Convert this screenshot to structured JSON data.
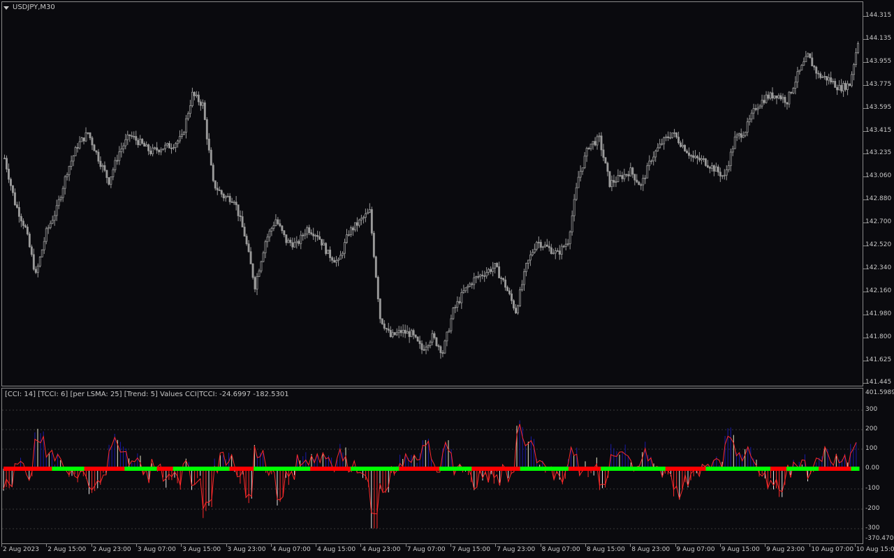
{
  "chart": {
    "symbol_title": "USDJPY,M30",
    "indicator_title": "[CCI: 14] [TCCI: 6] [per LSMA: 25] [Trend: 5] Values CCI|TCCI: -24.6997 -182.5301"
  },
  "price_axis": [
    "144.315",
    "144.135",
    "143.955",
    "143.775",
    "143.595",
    "143.415",
    "143.235",
    "143.060",
    "142.880",
    "142.700",
    "142.520",
    "142.340",
    "142.160",
    "141.980",
    "141.800",
    "141.625",
    "141.445"
  ],
  "indicator_axis": {
    "max_label": "401.5989",
    "min_label": "-370.4702",
    "levels": [
      "300",
      "200",
      "100",
      "0.00",
      "-100",
      "-200",
      "-300"
    ]
  },
  "time_axis": [
    "2 Aug 2023",
    "2 Aug 15:00",
    "2 Aug 23:00",
    "3 Aug 07:00",
    "3 Aug 15:00",
    "3 Aug 23:00",
    "4 Aug 07:00",
    "4 Aug 15:00",
    "4 Aug 23:00",
    "7 Aug 07:00",
    "7 Aug 15:00",
    "7 Aug 23:00",
    "8 Aug 07:00",
    "8 Aug 15:00",
    "8 Aug 23:00",
    "9 Aug 07:00",
    "9 Aug 15:00",
    "9 Aug 23:00",
    "10 Aug 07:00",
    "10 Aug 15:00"
  ],
  "colors": {
    "background": "#0a0a0e",
    "candle": "#9a9a9a",
    "cci_line": "#ff2a2a",
    "tcci_hist_up": "#1a1aa8",
    "trend_up": "#00ff00",
    "trend_down": "#ff0000",
    "grid": "#3a3a3a",
    "text": "#c8c8c8"
  },
  "chart_data": {
    "type": "candlestick_with_indicator",
    "price_close_path": [
      143.2,
      142.85,
      142.65,
      142.28,
      142.62,
      142.8,
      143.1,
      143.3,
      143.4,
      143.2,
      143.02,
      143.25,
      143.38,
      143.32,
      143.25,
      143.28,
      143.3,
      143.36,
      143.7,
      143.62,
      143.0,
      142.9,
      142.88,
      142.6,
      142.2,
      142.55,
      142.72,
      142.55,
      142.52,
      142.65,
      142.6,
      142.45,
      142.38,
      142.62,
      142.7,
      142.78,
      141.95,
      141.8,
      141.84,
      141.82,
      141.7,
      141.8,
      141.68,
      142.0,
      142.15,
      142.25,
      142.3,
      142.35,
      142.2,
      142.0,
      142.35,
      142.55,
      142.5,
      142.45,
      142.55,
      143.05,
      143.3,
      143.35,
      143.0,
      143.05,
      143.1,
      142.98,
      143.2,
      143.32,
      143.4,
      143.3,
      143.2,
      143.18,
      143.12,
      143.05,
      143.35,
      143.42,
      143.6,
      143.68,
      143.7,
      143.65,
      143.85,
      144.0,
      143.85,
      143.82,
      143.75,
      143.78,
      144.2
    ],
    "trend_segments": [
      {
        "from": "2 Aug 2023",
        "to": "2 Aug 15:00",
        "state": "down"
      },
      {
        "from": "2 Aug 15:00",
        "to": "2 Aug 23:00",
        "state": "down"
      },
      {
        "from": "3 Aug 07:00",
        "to": "3 Aug 15:00",
        "state": "up"
      },
      {
        "from": "3 Aug 23:00",
        "to": "4 Aug 07:00",
        "state": "up"
      },
      {
        "from": "4 Aug 15:00",
        "to": "4 Aug 23:00",
        "state": "up"
      },
      {
        "from": "7 Aug 07:00",
        "to": "7 Aug 15:00",
        "state": "down"
      },
      {
        "from": "7 Aug 23:00",
        "to": "8 Aug 07:00",
        "state": "up"
      },
      {
        "from": "8 Aug 15:00",
        "to": "8 Aug 23:00",
        "state": "down"
      },
      {
        "from": "9 Aug 07:00",
        "to": "9 Aug 15:00",
        "state": "up"
      },
      {
        "from": "10 Aug 07:00",
        "to": "10 Aug 15:00",
        "state": "down"
      }
    ],
    "cci_last": -24.6997,
    "tcci_last": -182.5301,
    "indicator_ylim": [
      -370.4702,
      401.5989
    ]
  }
}
